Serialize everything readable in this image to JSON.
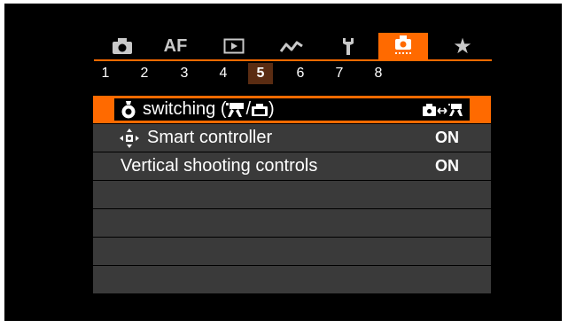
{
  "tabs": [
    {
      "name": "shooting-tab",
      "label": "",
      "icon": "camera-icon"
    },
    {
      "name": "af-tab",
      "label": "AF",
      "icon": ""
    },
    {
      "name": "playback-tab",
      "label": "",
      "icon": "playback-icon"
    },
    {
      "name": "wireless-tab",
      "label": "",
      "icon": "wireless-icon"
    },
    {
      "name": "setup-tab",
      "label": "",
      "icon": "wrench-icon"
    },
    {
      "name": "custom-function-tab",
      "label": "",
      "icon": "custom-camera-icon",
      "active": true
    },
    {
      "name": "my-menu-tab",
      "label": "★",
      "icon": "star-icon"
    }
  ],
  "pages": [
    "1",
    "2",
    "3",
    "4",
    "5",
    "6",
    "7",
    "8"
  ],
  "active_page": "5",
  "items": [
    {
      "label": "switching (",
      "label_tail": ")",
      "value": "",
      "value_icon": "camera-movie-switch-icon",
      "selected": true
    },
    {
      "label": "Smart controller",
      "value": "ON",
      "selected": false
    },
    {
      "label": "Vertical shooting controls",
      "value": "ON",
      "selected": false
    },
    {
      "label": "",
      "value": ""
    },
    {
      "label": "",
      "value": ""
    },
    {
      "label": "",
      "value": ""
    },
    {
      "label": "",
      "value": ""
    }
  ],
  "colors": {
    "accent": "#ff6a00",
    "row_bg": "#3a3a3a",
    "active_page_bg": "#5a2c12"
  }
}
